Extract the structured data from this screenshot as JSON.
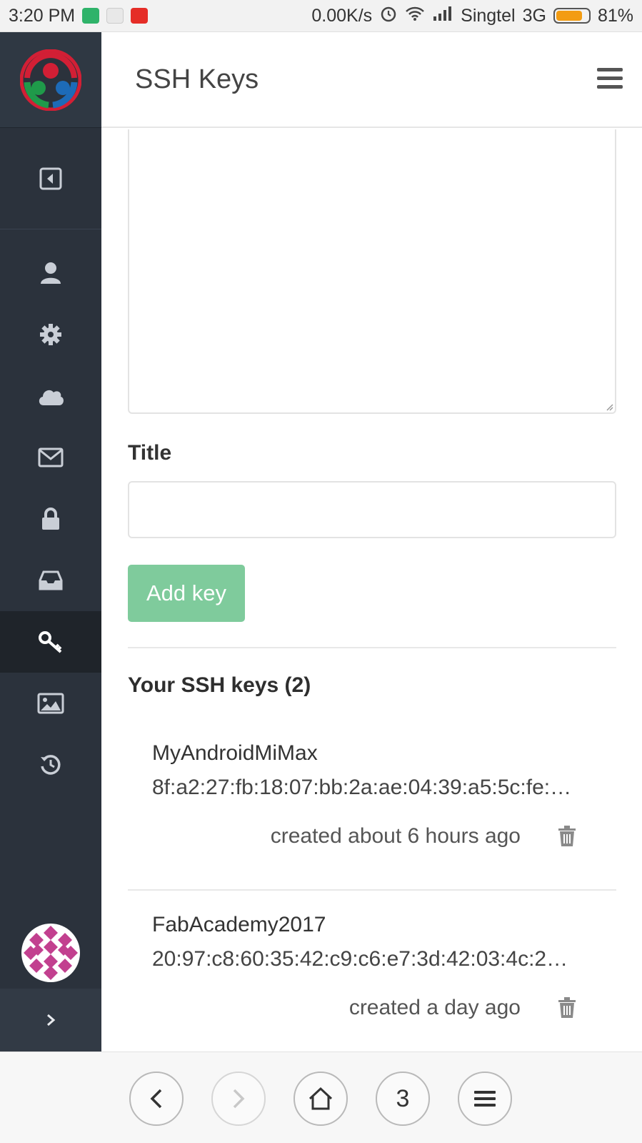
{
  "status_bar": {
    "time": "3:20 PM",
    "net_speed": "0.00K/s",
    "carrier": "Singtel",
    "network": "3G",
    "battery": "81%",
    "battery_level": 0.81
  },
  "header": {
    "title": "SSH Keys"
  },
  "sidebar": {
    "items": [
      {
        "name": "profile",
        "icon": "user-icon"
      },
      {
        "name": "settings",
        "icon": "gear-icon"
      },
      {
        "name": "cloud",
        "icon": "cloud-icon"
      },
      {
        "name": "email",
        "icon": "envelope-icon"
      },
      {
        "name": "password",
        "icon": "lock-icon"
      },
      {
        "name": "notifications",
        "icon": "inbox-icon"
      },
      {
        "name": "ssh-keys",
        "icon": "key-icon",
        "active": true
      },
      {
        "name": "avatar",
        "icon": "image-icon"
      },
      {
        "name": "history",
        "icon": "history-icon"
      }
    ]
  },
  "form": {
    "title_label": "Title",
    "title_value": "",
    "add_button": "Add key"
  },
  "keys": {
    "heading": "Your SSH keys (2)",
    "items": [
      {
        "name": "MyAndroidMiMax",
        "fingerprint": "8f:a2:27:fb:18:07:bb:2a:ae:04:39:a5:5c:fe:…",
        "created": "created about 6 hours ago"
      },
      {
        "name": "FabAcademy2017",
        "fingerprint": "20:97:c8:60:35:42:c9:c6:e7:3d:42:03:4c:2…",
        "created": "created a day ago"
      }
    ]
  },
  "browser_bar": {
    "tabs_count": "3"
  },
  "colors": {
    "sidebar": "#2b323c",
    "accent_button": "#7fcb9c",
    "active_nav": "#1f242a"
  }
}
